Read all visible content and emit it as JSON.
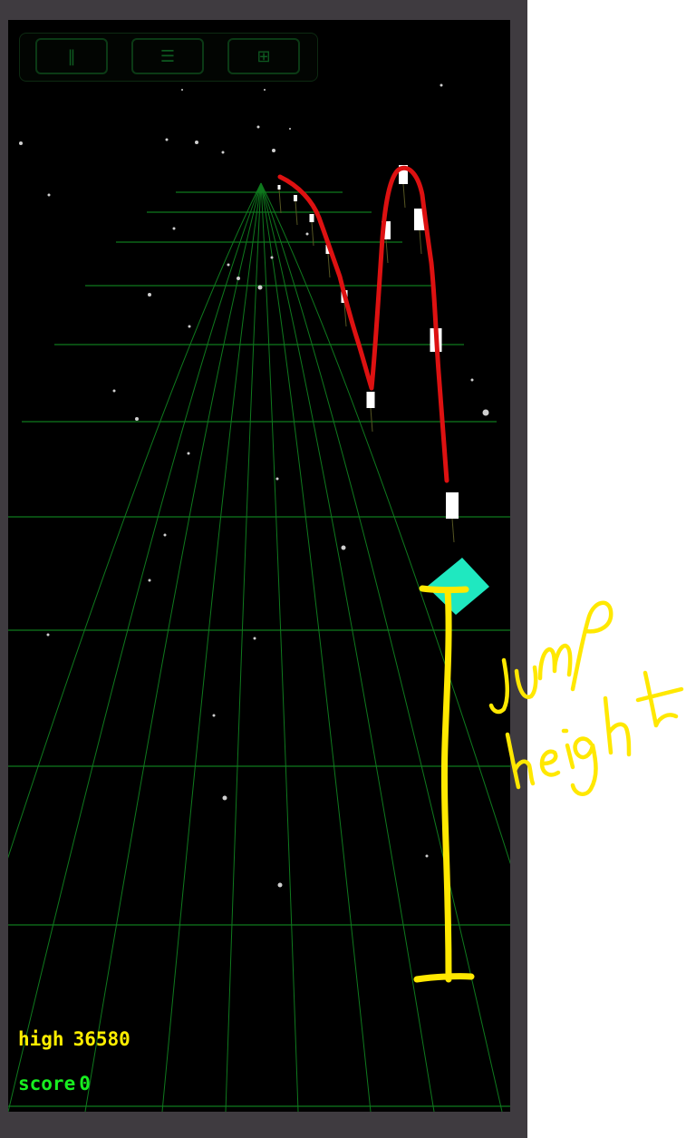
{
  "toolbar": {
    "pause_icon": "‖",
    "menu_icon": "☰",
    "grid_icon": "⊞"
  },
  "hud": {
    "high_label": "high",
    "high_value": "36580",
    "score_label": "score",
    "score_value": "0"
  },
  "colors": {
    "background": "#000000",
    "grid": "#0f7a1e",
    "player": "#1fe8c0",
    "high_text": "#ffee00",
    "score_text": "#18ee20",
    "trail": "#dd1111",
    "annotation": "#ffe800"
  },
  "annotation": {
    "text_line1": "JUMP",
    "text_line2": "height"
  }
}
